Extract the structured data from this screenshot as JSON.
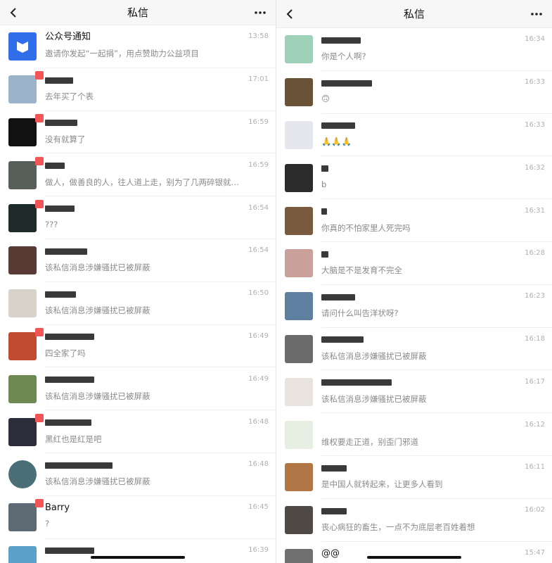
{
  "left": {
    "header": {
      "title": "私信"
    },
    "items": [
      {
        "name": "公众号通知",
        "preview": "邀请你发起“一起捐”，用点赞助力公益项目",
        "time": "13:58",
        "avatar": "#2f6ee8",
        "badge": false
      },
      {
        "name": "",
        "preview": "去年买了个表",
        "time": "17:01",
        "avatar": "#9bb4c9",
        "badge": true
      },
      {
        "name": "",
        "preview": "没有就算了",
        "time": "16:59",
        "avatar": "#111111",
        "badge": true
      },
      {
        "name": "",
        "preview": "做人，做善良的人，往人道上走，别为了几两碎银就出卖…",
        "time": "16:59",
        "avatar": "#566058",
        "badge": true
      },
      {
        "name": "",
        "preview": "???",
        "time": "16:54",
        "avatar": "#1f2a2a",
        "badge": true
      },
      {
        "name": "",
        "preview": "该私信消息涉嫌骚扰已被屏蔽",
        "time": "16:54",
        "avatar": "#5a3a34",
        "badge": false
      },
      {
        "name": "",
        "preview": "该私信消息涉嫌骚扰已被屏蔽",
        "time": "16:50",
        "avatar": "#d8d2c8",
        "badge": false
      },
      {
        "name": "",
        "preview": "四全家了吗",
        "time": "16:49",
        "avatar": "#c24a30",
        "badge": true
      },
      {
        "name": "",
        "preview": "该私信消息涉嫌骚扰已被屏蔽",
        "time": "16:49",
        "avatar": "#6e8a52",
        "badge": false
      },
      {
        "name": "",
        "preview": "黑红也是红是吧",
        "time": "16:48",
        "avatar": "#2b2e3a",
        "badge": true
      },
      {
        "name": "",
        "preview": "该私信消息涉嫌骚扰已被屏蔽",
        "time": "16:48",
        "avatar": "#4a6f76",
        "badge": false
      },
      {
        "name": "Barry",
        "preview": "?",
        "time": "16:45",
        "avatar": "#5d6a74",
        "badge": true
      },
      {
        "name": "",
        "preview": "",
        "time": "16:39",
        "avatar": "#5aa0c7",
        "badge": false
      }
    ]
  },
  "right": {
    "header": {
      "title": "私信"
    },
    "items": [
      {
        "name": "",
        "preview": "你是个人啊?",
        "time": "16:34",
        "avatar": "#9fd0b8"
      },
      {
        "name": "",
        "preview": "🙃",
        "time": "16:33",
        "avatar": "#6a5236"
      },
      {
        "name": "",
        "preview": "🙏🙏🙏",
        "time": "16:33",
        "avatar": "#e6e6ef"
      },
      {
        "name": "",
        "preview": "b",
        "time": "16:32",
        "avatar": "#2b2b2b"
      },
      {
        "name": "",
        "preview": "你真的不怕家里人死完吗",
        "time": "16:31",
        "avatar": "#7a5a3e"
      },
      {
        "name": "",
        "preview": "大脑是不是发育不完全",
        "time": "16:28",
        "avatar": "#c9a19a"
      },
      {
        "name": "",
        "preview": "请问什么叫告洋状呀?",
        "time": "16:23",
        "avatar": "#5f7fa0"
      },
      {
        "name": "",
        "preview": "该私信消息涉嫌骚扰已被屏蔽",
        "time": "16:18",
        "avatar": "#6b6b6b"
      },
      {
        "name": "",
        "preview": "该私信消息涉嫌骚扰已被屏蔽",
        "time": "16:17",
        "avatar": "#e9e3dd"
      },
      {
        "name": "",
        "preview": "维权要走正道，别歪门邪道",
        "time": "16:12",
        "avatar": "#e7efe3"
      },
      {
        "name": "",
        "preview": "是中国人就转起来，让更多人看到",
        "time": "16:11",
        "avatar": "#b07645"
      },
      {
        "name": "",
        "preview": "丧心病狂的畜生，一点不为底层老百姓着想",
        "time": "16:02",
        "avatar": "#4f4a45"
      },
      {
        "name": "@@",
        "preview": "",
        "time": "15:47",
        "avatar": "#707070"
      }
    ]
  }
}
